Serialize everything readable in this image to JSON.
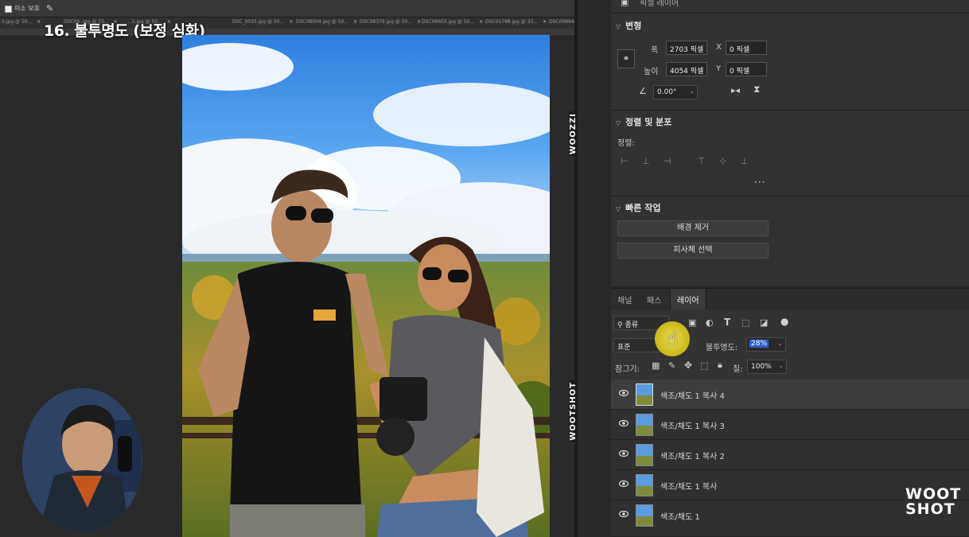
{
  "options_bar": {
    "checkbox_label": "이소 보호"
  },
  "doc_tabs": [
    "0.jpg @ 50...",
    "DSC04..jpg @ 33...",
    "...5.jpg @ 50...",
    "DSC_0035.jpg @ 50...",
    "DSC08004.jpg @ 50...",
    "DSC08379.jpg @ 50...",
    "DSC08603.jpg @ 50...",
    "DSC01788.jpg @ 33...",
    "DSC09894..."
  ],
  "step_title": "16. 불투명도 (보정 심화)",
  "watermark_vertical": [
    "WOOZZI",
    "WOOTSHOT"
  ],
  "properties": {
    "partial_header": "픽셀 레이어",
    "transform": {
      "title": "변형",
      "width_label": "폭",
      "width_value": "2703 픽셀",
      "height_label": "높이",
      "height_value": "4054 픽셀",
      "x_label": "X",
      "x_value": "0 픽셀",
      "y_label": "Y",
      "y_value": "0 픽셀",
      "angle_value": "0.00°"
    },
    "align": {
      "title": "정렬 및 분포",
      "sub_label": "정렬:"
    },
    "quick_actions": {
      "title": "빠른 작업",
      "remove_bg": "배경 제거",
      "select_subject": "피사체 선택"
    }
  },
  "layers_panel": {
    "tabs": [
      "채널",
      "패스",
      "레이어"
    ],
    "active_tab": "레이어",
    "filter_label": "종류",
    "blend_mode": "표준",
    "opacity_label": "불투명도:",
    "opacity_value": "28%",
    "lock_label": "잠그기:",
    "fill_label": "칠:",
    "fill_value": "100%",
    "layers": [
      {
        "name": "색조/채도 1 복사 4",
        "selected": true
      },
      {
        "name": "색조/채도 1 복사 3",
        "selected": false
      },
      {
        "name": "색조/채도 1 복사 2",
        "selected": false
      },
      {
        "name": "색조/채도 1 복사",
        "selected": false
      },
      {
        "name": "색조/채도 1",
        "selected": false
      }
    ]
  },
  "logo": {
    "line1": "WOOT",
    "line2": "SHOT"
  }
}
